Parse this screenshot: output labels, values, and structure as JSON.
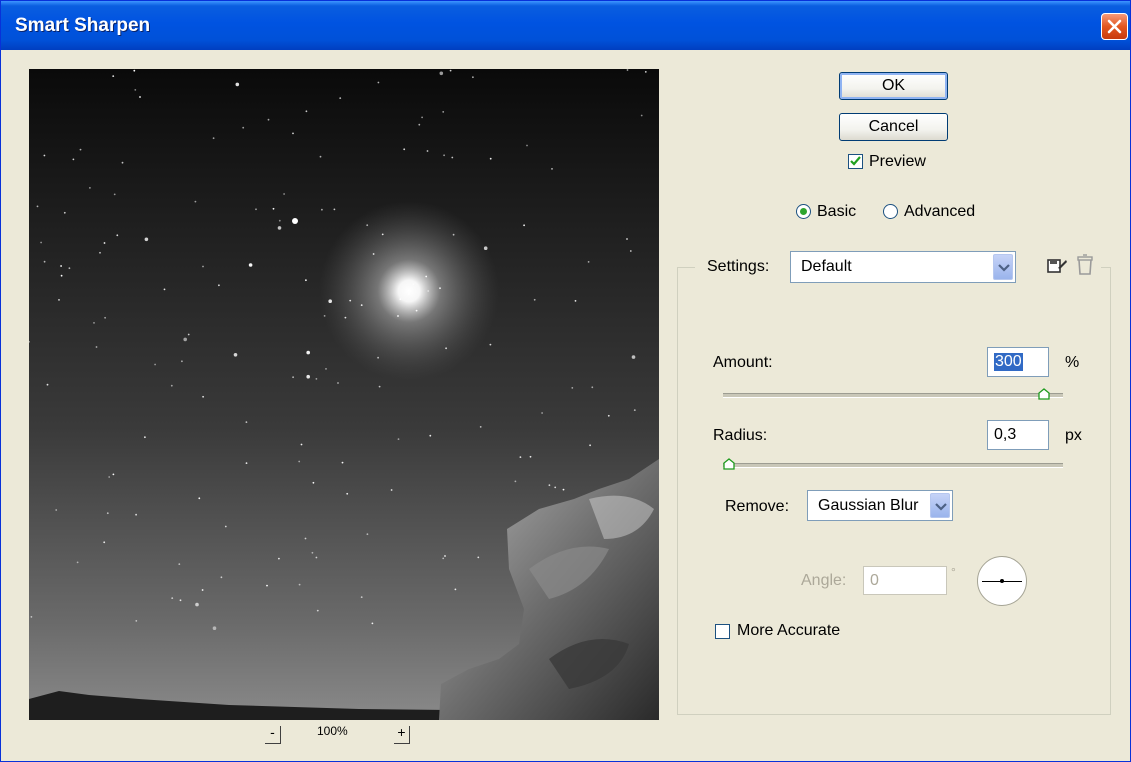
{
  "window": {
    "title": "Smart Sharpen"
  },
  "buttons": {
    "ok": "OK",
    "cancel": "Cancel"
  },
  "preview_checkbox": {
    "label": "Preview",
    "checked": true
  },
  "mode": {
    "basic": "Basic",
    "advanced": "Advanced",
    "selected": "basic"
  },
  "settings": {
    "label": "Settings:",
    "value": "Default"
  },
  "amount": {
    "label": "Amount:",
    "value": "300",
    "unit": "%",
    "slider_fraction": 0.96
  },
  "radius": {
    "label": "Radius:",
    "value": "0,3",
    "unit": "px",
    "slider_fraction": 0.0
  },
  "remove": {
    "label": "Remove:",
    "value": "Gaussian Blur"
  },
  "angle": {
    "label": "Angle:",
    "value": "0",
    "unit": "°"
  },
  "more_accurate": {
    "label": "More Accurate",
    "checked": false
  },
  "zoom": {
    "value": "100%",
    "minus": "-",
    "plus": "+"
  },
  "colors": {
    "title_bar": "#0053e1",
    "dialog_bg": "#ece9d8",
    "accent_green": "#2ea52e",
    "close_red": "#e2571f"
  },
  "icons": [
    "close-icon",
    "save-settings-icon",
    "delete-settings-icon",
    "chevron-down-icon",
    "checkmark-icon"
  ]
}
